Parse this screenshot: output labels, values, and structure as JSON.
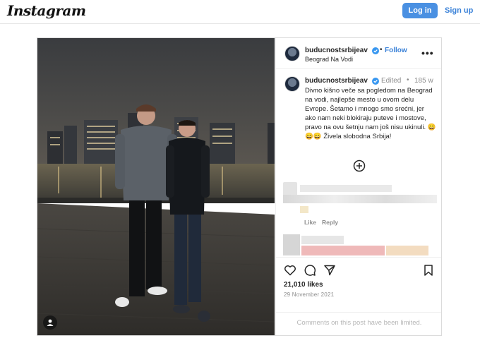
{
  "header": {
    "logo_text": "Instagram",
    "login_label": "Log in",
    "signup_label": "Sign up"
  },
  "post": {
    "username": "buducnostsrbijeav",
    "follow_label": "Follow",
    "location": "Beograd Na Vodi",
    "more_label": "•••",
    "caption": {
      "username": "buducnostsrbijeav",
      "edited_label": "Edited",
      "age": "185 w",
      "text": "Divno kišno veče sa pogledom na Beograd na vodi, najlepše mesto u ovom delu Evrope. Šetamo i mnogo smo srećni, jer ako nam neki blokiraju puteve i mostove, pravo na ovu šetnju nam još nisu ukinuli. 😄😄😄 Živela slobodna Srbija!"
    },
    "comment_actions": {
      "like_label": "Like",
      "reply_label": "Reply"
    },
    "likes": "21,010 likes",
    "date": "29 November 2021",
    "comments_limited": "Comments on this post have been limited."
  },
  "colors": {
    "accent": "#4a90e2",
    "link": "#3b82d8",
    "verified": "#3897f0"
  },
  "icons": [
    "user-tag-icon",
    "verified-badge-icon",
    "more-options-icon",
    "add-comment-icon",
    "heart-icon",
    "comment-icon",
    "share-icon",
    "bookmark-icon"
  ]
}
